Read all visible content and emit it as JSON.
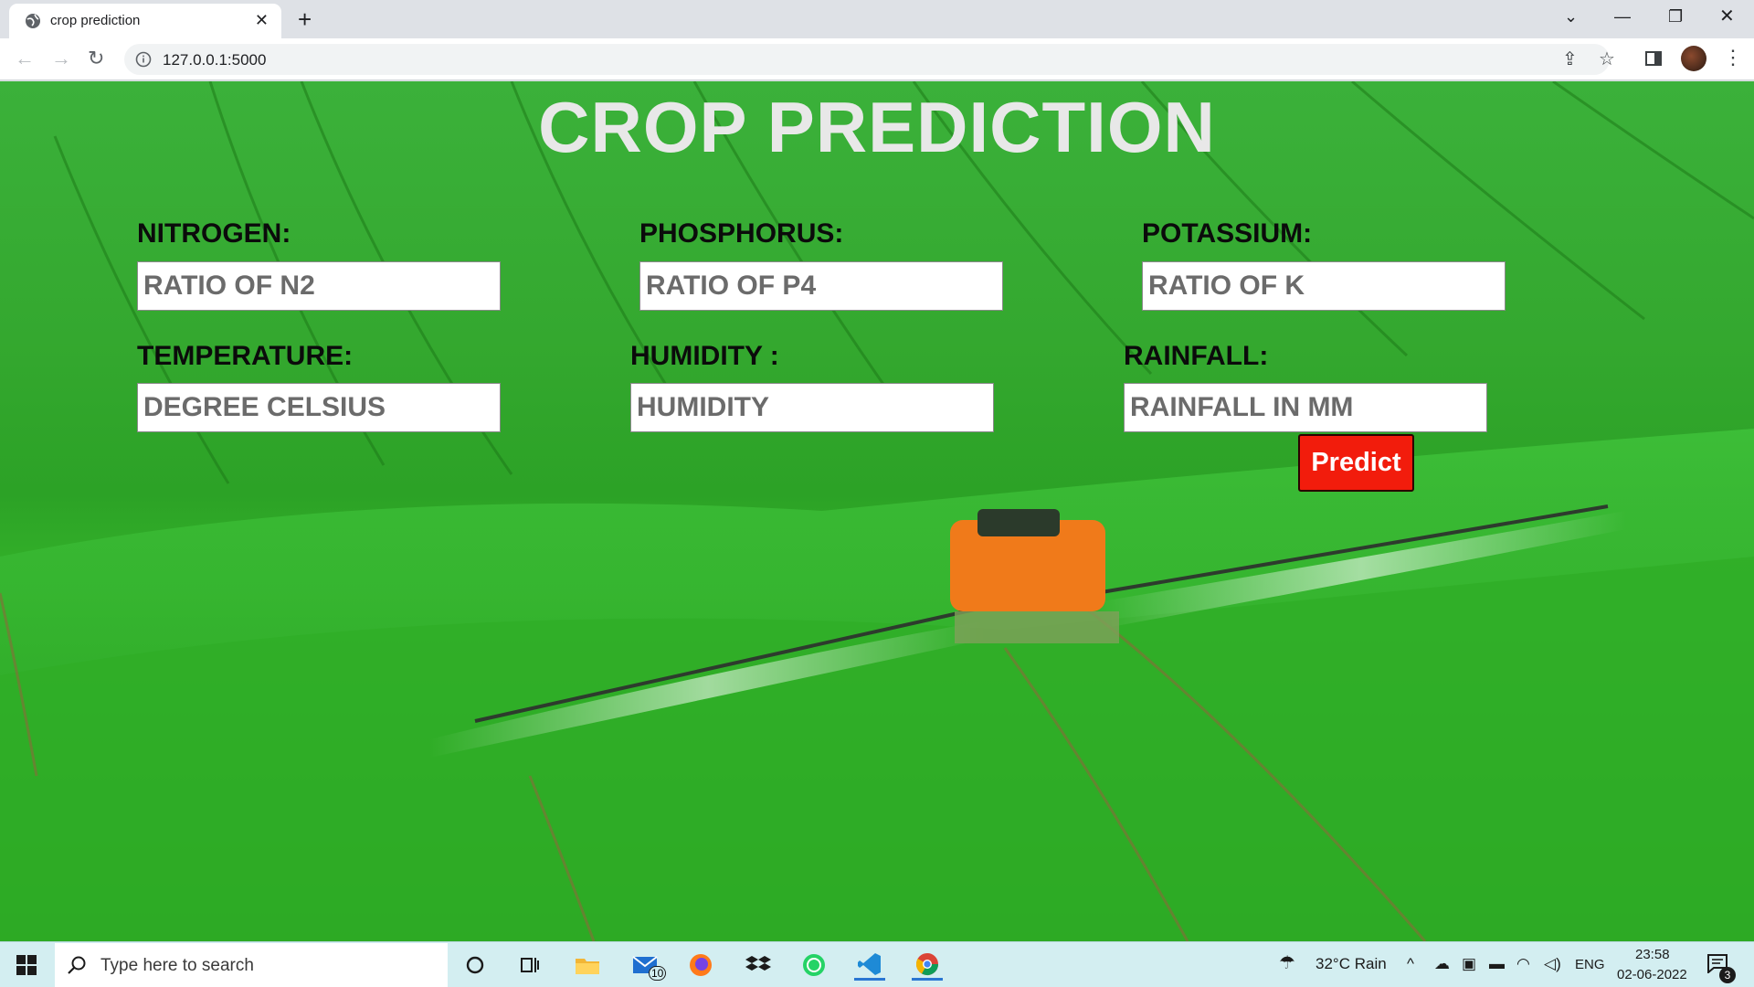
{
  "browser": {
    "tab_title": "crop prediction",
    "close_glyph": "✕",
    "new_tab_glyph": "+",
    "url": "127.0.0.1:5000",
    "window_controls": {
      "dropdown": "⌄",
      "minimize": "—",
      "maximize": "❐",
      "close": "✕"
    },
    "nav": {
      "back": "←",
      "forward": "→",
      "reload": "↻"
    },
    "share_glyph": "⇪",
    "star_glyph": "☆",
    "menu_glyph": "⋮"
  },
  "page": {
    "title": "CROP PREDICTION",
    "fields": [
      {
        "label": "NITROGEN:",
        "placeholder": "RATIO OF N2"
      },
      {
        "label": "PHOSPHORUS:",
        "placeholder": "RATIO OF P4"
      },
      {
        "label": "POTASSIUM:",
        "placeholder": "RATIO OF K"
      },
      {
        "label": "TEMPERATURE:",
        "placeholder": "DEGREE CELSIUS"
      },
      {
        "label": "HUMIDITY :",
        "placeholder": "HUMIDITY"
      },
      {
        "label": "RAINFALL:",
        "placeholder": "RAINFALL IN MM"
      }
    ],
    "submit_label": "Predict",
    "submit_color": "#f21c0c",
    "background_description_icon": "green-field-with-tractor-sprayer"
  },
  "taskbar": {
    "search_placeholder": "Type here to search",
    "mail_badge": "10",
    "weather": "32°C  Rain",
    "language": "ENG",
    "time": "23:58",
    "date": "02-06-2022",
    "notification_count": "3",
    "apps": [
      "cortana-icon",
      "task-view-icon",
      "file-explorer-icon",
      "mail-icon",
      "firefox-icon",
      "dropbox-icon",
      "whatsapp-icon",
      "vscode-icon",
      "chrome-icon"
    ]
  }
}
